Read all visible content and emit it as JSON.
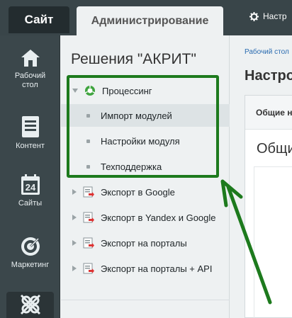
{
  "topbar": {
    "tab_site": "Сайт",
    "tab_admin": "Администрирование",
    "settings_label": "Настр"
  },
  "leftpanel": {
    "items": [
      {
        "label": "Рабочий стол",
        "icon": "home-icon"
      },
      {
        "label": "Контент",
        "icon": "document-icon"
      },
      {
        "label": "Сайты",
        "icon": "calendar-icon",
        "number": "24"
      },
      {
        "label": "Маркетинг",
        "icon": "target-icon"
      },
      {
        "label": "",
        "icon": "marketplace-icon"
      }
    ]
  },
  "menu": {
    "title": "Решения \"АКРИТ\"",
    "items": [
      {
        "label": "Процессинг",
        "level": 0,
        "expanded": true,
        "icon": "processing-icon"
      },
      {
        "label": "Импорт модулей",
        "level": 1,
        "selected": true
      },
      {
        "label": "Настройки модуля",
        "level": 1
      },
      {
        "label": "Техподдержка",
        "level": 1
      },
      {
        "label": "Экспорт в Google",
        "level": 0,
        "expanded": false,
        "icon": "export-icon"
      },
      {
        "label": "Экспорт в Yandex и Google",
        "level": 0,
        "expanded": false,
        "icon": "export-icon"
      },
      {
        "label": "Экспорт на порталы",
        "level": 0,
        "expanded": false,
        "icon": "export-icon"
      },
      {
        "label": "Экспорт на порталы + API",
        "level": 0,
        "expanded": false,
        "icon": "export-icon"
      }
    ]
  },
  "content": {
    "breadcrumb": "Рабочий стол",
    "title": "Настро",
    "tab_label": "Общие н",
    "section_heading": "Общи"
  },
  "colors": {
    "topbar": "#394549",
    "left_panel": "#3b474b",
    "annotation_green": "#1d7a1d",
    "link_blue": "#2a6bb0"
  }
}
